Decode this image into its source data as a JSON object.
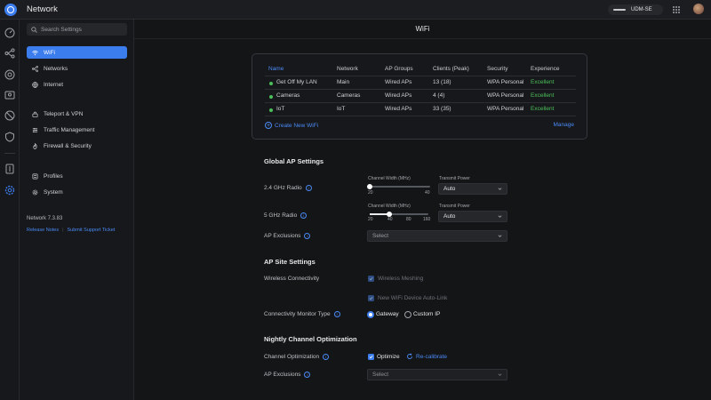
{
  "app": {
    "title": "Network",
    "device": "UDM-SE"
  },
  "rail": {
    "icons": [
      "dashboard-icon",
      "topology-icon",
      "devices-icon",
      "clients-icon",
      "insights-icon",
      "protect-icon",
      "system-log-icon",
      "settings-icon"
    ]
  },
  "nav": {
    "search_placeholder": "Search Settings",
    "items": [
      {
        "label": "WiFi",
        "icon": "wifi-icon"
      },
      {
        "label": "Networks",
        "icon": "networks-icon"
      },
      {
        "label": "Internet",
        "icon": "globe-icon"
      },
      {
        "label": "Teleport & VPN",
        "icon": "teleport-icon"
      },
      {
        "label": "Traffic Management",
        "icon": "traffic-icon"
      },
      {
        "label": "Firewall & Security",
        "icon": "firewall-icon"
      },
      {
        "label": "Profiles",
        "icon": "profiles-icon"
      },
      {
        "label": "System",
        "icon": "gear-icon"
      }
    ],
    "version": "Network 7.3.83",
    "release_notes": "Release Notes",
    "support_ticket": "Submit Support Ticket"
  },
  "page": {
    "title": "WiFi"
  },
  "wifi_table": {
    "headers": [
      "Name",
      "Network",
      "AP Groups",
      "Clients (Peak)",
      "Security",
      "Experience"
    ],
    "rows": [
      {
        "name": "Get Off My LAN",
        "network": "Main",
        "ap_groups": "Wired APs",
        "clients": "13 (18)",
        "security": "WPA Personal",
        "experience": "Excellent"
      },
      {
        "name": "Cameras",
        "network": "Cameras",
        "ap_groups": "Wired APs",
        "clients": "4 (4)",
        "security": "WPA Personal",
        "experience": "Excellent"
      },
      {
        "name": "IoT",
        "network": "IoT",
        "ap_groups": "Wired APs",
        "clients": "33 (35)",
        "security": "WPA Personal",
        "experience": "Excellent"
      }
    ],
    "create_label": "Create New WiFi",
    "manage_label": "Manage"
  },
  "global_ap": {
    "heading": "Global AP Settings",
    "radio_24": {
      "label": "2.4 GHz Radio",
      "channel_width_label": "Channel Width (MHz)",
      "ticks": [
        "20",
        "40"
      ],
      "selected_fraction": 0.0,
      "transmit_power_label": "Transmit Power",
      "transmit_power": "Auto"
    },
    "radio_5": {
      "label": "5 GHz Radio",
      "channel_width_label": "Channel Width (MHz)",
      "ticks": [
        "20",
        "40",
        "80",
        "160"
      ],
      "selected_fraction": 0.333,
      "transmit_power_label": "Transmit Power",
      "transmit_power": "Auto"
    },
    "ap_exclusions_label": "AP Exclusions",
    "ap_exclusions_value": "Select"
  },
  "ap_site": {
    "heading": "AP Site Settings",
    "wireless_connectivity_label": "Wireless Connectivity",
    "wireless_meshing": "Wireless Meshing",
    "auto_link": "New WiFi Device Auto-Link",
    "connectivity_monitor_label": "Connectivity Monitor Type",
    "option_gateway": "Gateway",
    "option_custom_ip": "Custom IP",
    "selected": "Gateway"
  },
  "nightly": {
    "heading": "Nightly Channel Optimization",
    "channel_optimization_label": "Channel Optimization",
    "optimize_label": "Optimize",
    "recalibrate_label": "Re-calibrate",
    "ap_exclusions_label": "AP Exclusions",
    "ap_exclusions_value": "Select"
  },
  "colors": {
    "accent": "#3C7DEE",
    "link": "#4A8AF5",
    "success": "#4BBF5A",
    "background": "#141517"
  }
}
